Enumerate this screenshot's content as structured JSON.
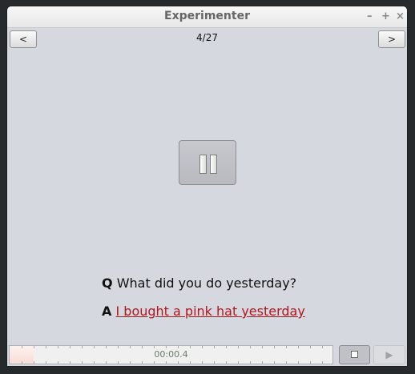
{
  "window": {
    "title": "Experimenter",
    "controls": [
      "–",
      "+",
      "×"
    ]
  },
  "nav": {
    "prev_label": "<",
    "next_label": ">",
    "page": "4/27"
  },
  "qa": {
    "q_label": "Q",
    "question": "What did you do yesterday?",
    "a_label": "A",
    "answer": "I bought a pink hat yesterday"
  },
  "player": {
    "time": "00:00.4",
    "progress_fraction": 0.075,
    "play_icon": "▶"
  }
}
